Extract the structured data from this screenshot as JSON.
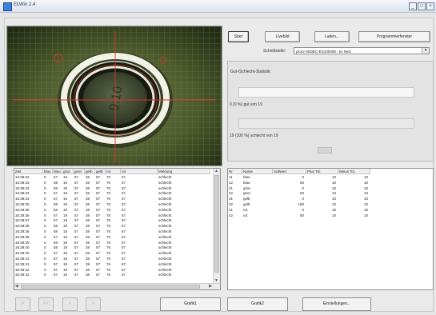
{
  "window": {
    "title": "ELWin 2.4",
    "buttons": {
      "minimize": "_",
      "maximize": "□",
      "close": "×"
    }
  },
  "camera": {
    "overlay_text": "9:10"
  },
  "toolbar": {
    "start": "Start",
    "livebild": "Livebild",
    "laden": "Laden...",
    "programmierfenster": "Programmierfenster"
  },
  "interface": {
    "label": "Schnittstelle:",
    "value": "pictor M40EC-ES100009 - ex Netz"
  },
  "stats": {
    "title": "Gut-/Schlecht-Statistik:",
    "good_text": "0 (0 %) gut von 19",
    "good_fraction": 0.0,
    "bad_text": "19 (100 %) schlecht von 19",
    "bad_fraction": 1.0
  },
  "log": {
    "columns": [
      "Zeit",
      "blau",
      "blau",
      "grün",
      "grün",
      "gelb",
      "gelb",
      "rot",
      "rot",
      "Meldung"
    ],
    "rows": [
      [
        "16:38:32",
        "0",
        "57",
        "19",
        "57",
        "38",
        "57",
        "76",
        "57",
        "schlecht"
      ],
      [
        "16:38:33",
        "0",
        "58",
        "19",
        "57",
        "38",
        "57",
        "76",
        "57",
        "schlecht"
      ],
      [
        "16:38:33",
        "0",
        "58",
        "19",
        "57",
        "38",
        "57",
        "76",
        "57",
        "schlecht"
      ],
      [
        "16:38:34",
        "0",
        "57",
        "19",
        "57",
        "38",
        "57",
        "76",
        "57",
        "schlecht"
      ],
      [
        "16:38:34",
        "0",
        "57",
        "19",
        "57",
        "38",
        "57",
        "76",
        "57",
        "schlecht"
      ],
      [
        "16:38:35",
        "0",
        "58",
        "19",
        "57",
        "38",
        "57",
        "76",
        "57",
        "schlecht"
      ],
      [
        "16:38:36",
        "0",
        "58",
        "19",
        "57",
        "38",
        "57",
        "76",
        "57",
        "schlecht"
      ],
      [
        "16:38:36",
        "0",
        "57",
        "19",
        "57",
        "38",
        "57",
        "76",
        "57",
        "schlecht"
      ],
      [
        "16:38:37",
        "0",
        "57",
        "19",
        "57",
        "38",
        "57",
        "76",
        "57",
        "schlecht"
      ],
      [
        "16:38:38",
        "0",
        "58",
        "19",
        "57",
        "38",
        "57",
        "76",
        "57",
        "schlecht"
      ],
      [
        "16:38:38",
        "0",
        "58",
        "19",
        "57",
        "38",
        "57",
        "76",
        "57",
        "schlecht"
      ],
      [
        "16:38:39",
        "0",
        "57",
        "19",
        "57",
        "38",
        "57",
        "76",
        "57",
        "schlecht"
      ],
      [
        "16:38:39",
        "0",
        "58",
        "19",
        "57",
        "38",
        "57",
        "76",
        "57",
        "schlecht"
      ],
      [
        "16:38:40",
        "0",
        "58",
        "19",
        "57",
        "38",
        "57",
        "76",
        "57",
        "schlecht"
      ],
      [
        "16:38:40",
        "0",
        "57",
        "19",
        "57",
        "38",
        "57",
        "76",
        "57",
        "schlecht"
      ],
      [
        "16:38:41",
        "0",
        "57",
        "19",
        "57",
        "38",
        "57",
        "76",
        "57",
        "schlecht"
      ],
      [
        "16:38:41",
        "0",
        "57",
        "19",
        "57",
        "38",
        "57",
        "76",
        "57",
        "schlecht"
      ],
      [
        "16:38:42",
        "0",
        "57",
        "19",
        "57",
        "38",
        "57",
        "76",
        "57",
        "schlecht"
      ],
      [
        "16:38:42",
        "0",
        "57",
        "19",
        "57",
        "38",
        "57",
        "76",
        "57",
        "schlecht"
      ]
    ]
  },
  "prog": {
    "columns": [
      "Nr.",
      "Name",
      "Sollwert",
      "Plus Tol.",
      "Minus Tol."
    ],
    "rows": [
      [
        "11",
        "blau",
        "0",
        "10",
        "10"
      ],
      [
        "12",
        "blau",
        "60",
        "10",
        "10"
      ],
      [
        "21",
        "grün",
        "0",
        "10",
        "10"
      ],
      [
        "22",
        "grün",
        "50",
        "10",
        "10"
      ],
      [
        "31",
        "gelb",
        "0",
        "10",
        "10"
      ],
      [
        "32",
        "gelb",
        "180",
        "10",
        "10"
      ],
      [
        "41",
        "rot",
        "0",
        "10",
        "10"
      ],
      [
        "42",
        "rot",
        "50",
        "10",
        "10"
      ]
    ]
  },
  "bottom": {
    "nav": [
      "|<",
      "<<",
      "<",
      ">"
    ],
    "grafik1": "Grafik1",
    "grafik2": "Grafik2",
    "einstellungen": "Einstellungen..."
  },
  "colors": {
    "title_bg": "#dde3ee",
    "crosshair": "#d43a2a",
    "camera_bg": "#2c3a1d"
  }
}
